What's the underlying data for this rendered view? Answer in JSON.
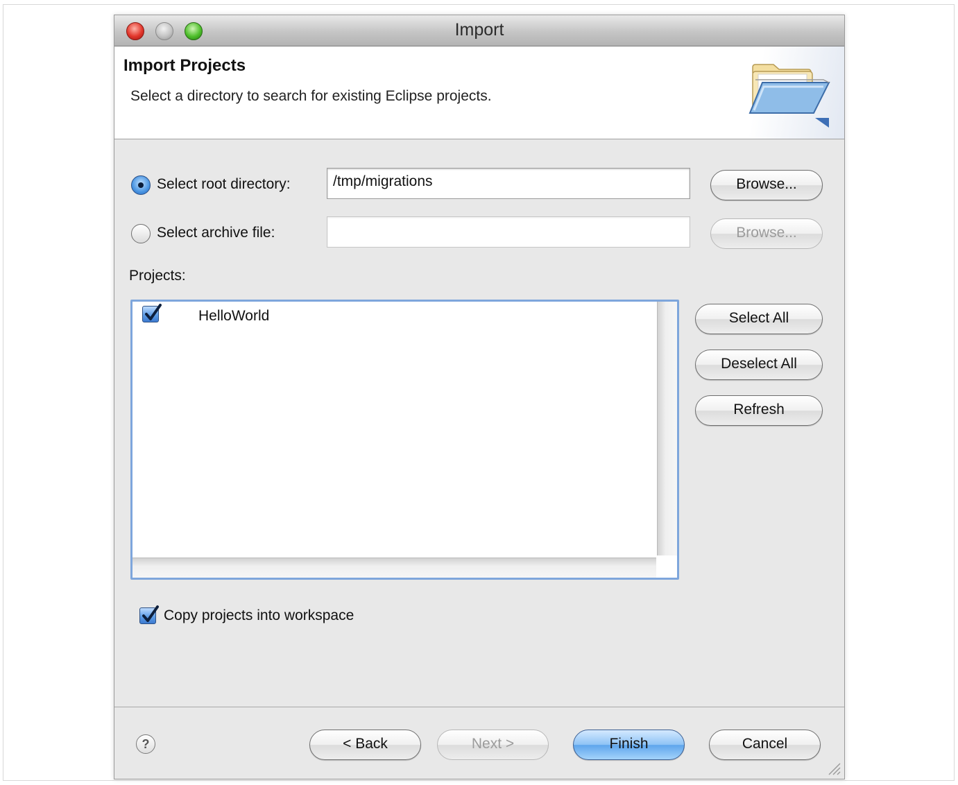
{
  "window": {
    "title": "Import"
  },
  "header": {
    "title": "Import Projects",
    "description": "Select a directory to search for existing Eclipse projects.",
    "icon": "open-folder-icon"
  },
  "source": {
    "root_directory": {
      "label": "Select root directory:",
      "selected": true,
      "value": "/tmp/migrations",
      "browse_label": "Browse..."
    },
    "archive_file": {
      "label": "Select archive file:",
      "selected": false,
      "value": "",
      "browse_label": "Browse...",
      "browse_enabled": false
    }
  },
  "projects": {
    "label": "Projects:",
    "items": [
      {
        "name": "HelloWorld",
        "checked": true
      }
    ],
    "select_all_label": "Select All",
    "deselect_all_label": "Deselect All",
    "refresh_label": "Refresh"
  },
  "options": {
    "copy_into_workspace": {
      "label": "Copy projects into workspace",
      "checked": true
    }
  },
  "footer": {
    "help_icon": "help-icon",
    "help_symbol": "?",
    "back_label": "< Back",
    "next_label": "Next >",
    "next_enabled": false,
    "finish_label": "Finish",
    "cancel_label": "Cancel"
  },
  "colors": {
    "accent": "#5ea5ec",
    "window_bg": "#e8e8e8",
    "list_focus_border": "#7ea6dc"
  }
}
